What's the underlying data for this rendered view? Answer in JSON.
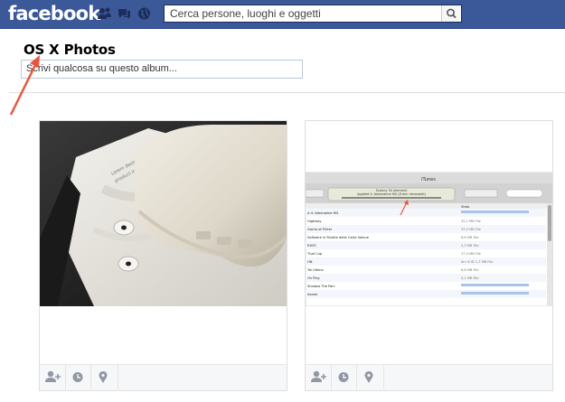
{
  "header": {
    "logo": "facebook",
    "search_placeholder": "Cerca persone, luoghi e oggetti",
    "icons": [
      "friend-requests-icon",
      "messages-icon",
      "notifications-icon",
      "search-icon"
    ]
  },
  "album": {
    "title": "OS X Photos",
    "description_placeholder": "Scrivi qualcosa su questo album..."
  },
  "photos": [
    {
      "id": "earpods",
      "actions": [
        "tag-person-icon",
        "date-icon",
        "location-icon"
      ]
    },
    {
      "id": "itunes-screenshot",
      "actions": [
        "tag-person-icon",
        "date-icon",
        "location-icon"
      ]
    }
  ],
  "colors": {
    "brand": "#3b5998",
    "annotation": "#e8563e"
  }
}
